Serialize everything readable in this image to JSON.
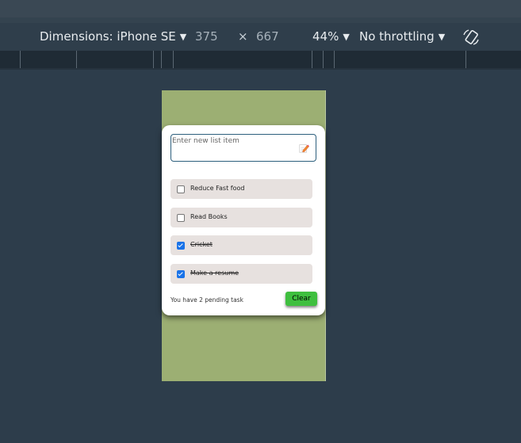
{
  "devtools": {
    "dimensions_label": "Dimensions: iPhone SE",
    "width": "375",
    "times": "×",
    "height": "667",
    "zoom": "44%",
    "throttling": "No throttling",
    "rotate_icon": "rotate-icon"
  },
  "app": {
    "input_placeholder": "Enter new list item",
    "input_value": "",
    "add_icon": "pencil-icon",
    "tasks": [
      {
        "label": "Reduce Fast food",
        "checked": false
      },
      {
        "label": "Read Books",
        "checked": false
      },
      {
        "label": "Cricket",
        "checked": true
      },
      {
        "label": "Make a resume",
        "checked": true
      }
    ],
    "pending_text": "You have 2 pending task",
    "clear_label": "Clear"
  },
  "colors": {
    "page_bg": "#2d3d4b",
    "device_bg": "#9caf73",
    "task_bg": "#e7e1df",
    "clear_bg": "#3fbf3f",
    "checkbox_checked": "#1a73e8"
  }
}
